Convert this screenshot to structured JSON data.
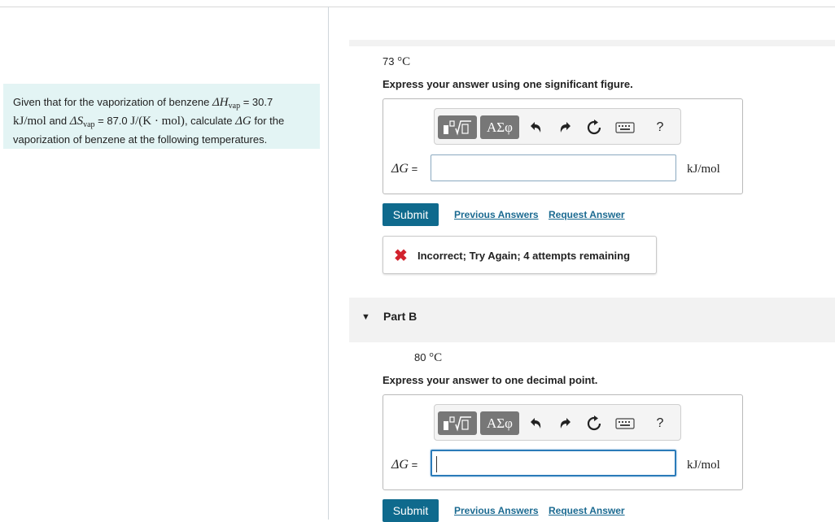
{
  "problem": {
    "t1": "Given that for the vaporization of benzene ",
    "dh_sym": "ΔH",
    "dh_sub": "vap",
    "dh_val": " = 30.7",
    "dh_unit": "kJ/mol",
    "t2": " and ",
    "ds_sym": "ΔS",
    "ds_sub": "vap",
    "ds_val": " = 87.0 ",
    "ds_unit": "J/(K · mol)",
    "t3": ", calculate ",
    "dg_sym": "ΔG",
    "t4": " for the vaporization of benzene at the following temperatures."
  },
  "partA": {
    "temp_val": "73 ",
    "temp_unit": "°C",
    "instruction": "Express your answer using one significant figure.",
    "lhs": "ΔG",
    "eq": " =",
    "input_value": "",
    "unit": "kJ/mol",
    "submit": "Submit",
    "prev": "Previous Answers",
    "request": "Request Answer",
    "feedback_icon": "✖",
    "feedback": "Incorrect; Try Again; 4 attempts remaining"
  },
  "partB": {
    "title": "Part B",
    "temp_val": "80 ",
    "temp_unit": "°C",
    "instruction": "Express your answer to one decimal point.",
    "lhs": "ΔG",
    "eq": " =",
    "input_value": "",
    "unit": "kJ/mol",
    "submit": "Submit",
    "prev": "Previous Answers",
    "request": "Request Answer"
  },
  "toolbar": {
    "greek": "ΑΣφ",
    "help": "?",
    "icons": [
      "templates-icon",
      "greek-symbols-icon",
      "undo-icon",
      "redo-icon",
      "reset-icon",
      "keyboard-icon",
      "help-icon"
    ]
  }
}
